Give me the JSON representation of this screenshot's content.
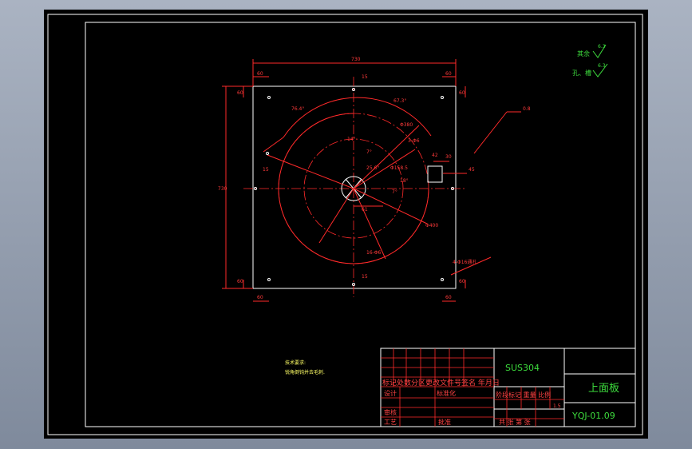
{
  "drawing": {
    "dims": {
      "overall_width": "730",
      "overall_height": "730",
      "corner_dx": "60",
      "corner_dy": "60",
      "top_center": "15",
      "bottom_center": "15",
      "mid_left": "15",
      "mid_right": "45",
      "center_offset": "61",
      "slot_w": "42",
      "slot_h": "30",
      "angle_a": "76.4°",
      "angle_b": "67.3°",
      "angle_c": "14°",
      "angle_d": "7°",
      "angle_e": "25.6°",
      "angle_f": "18°",
      "angle_g": "7°",
      "dia_1": "Φ380",
      "dia_2": "Φ400",
      "dia_3": "Φ158.5",
      "hole_callout": "3-Φ6",
      "hole_callout_2": "16-Φ6",
      "corner_holes": "4-Φ16通孔",
      "leader_note": "0.8"
    },
    "roughness": {
      "label_1": "其余",
      "value_1": "6.3",
      "label_2": "孔、槽",
      "value_2": "6.3"
    },
    "tech_requirements": {
      "title": "技术要求:",
      "line_1": "锐角倒钝并去毛刺."
    },
    "title_block": {
      "material": "SUS304",
      "part_name": "上面板",
      "drawing_number": "YQJ-01.09",
      "row_header": "标记处数分区更改文件号签名 年月日",
      "design": "设计",
      "standardize": "标准化",
      "stage_mark": "阶段标记 重量 比例",
      "scale": "1.5",
      "review": "审核",
      "process": "工艺",
      "approve": "批准",
      "sheets": "共  张 第  张"
    }
  }
}
